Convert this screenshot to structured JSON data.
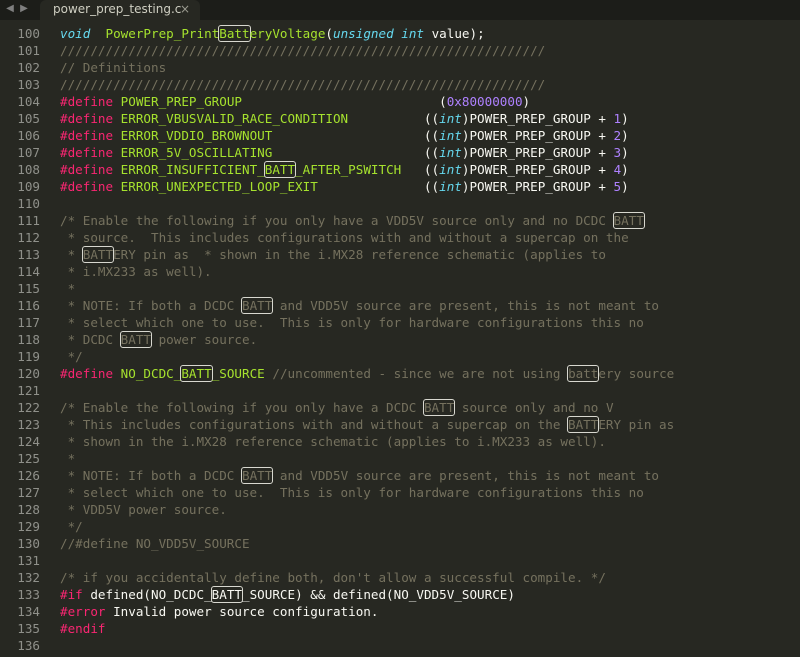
{
  "tab": {
    "filename": "power_prep_testing.c",
    "close_glyph": "×"
  },
  "nav": {
    "back_glyph": "◀",
    "forward_glyph": "▶"
  },
  "colors": {
    "background": "#272822",
    "keyword": "#f92672",
    "function": "#a6e22e",
    "type": "#66d9ef",
    "number": "#ae81ff",
    "comment": "#75715e",
    "text": "#f8f8f2",
    "line_number": "#8f908a"
  },
  "search_highlight": "batt",
  "lines": [
    {
      "no": "100",
      "tokens": [
        [
          "ty",
          "void"
        ],
        [
          "",
          "  "
        ],
        [
          "fn",
          "PowerPrep_Print"
        ],
        [
          "fn hl",
          "Batt"
        ],
        [
          "fn",
          "eryVoltage"
        ],
        [
          "",
          "("
        ],
        [
          "ty",
          "unsigned int"
        ],
        [
          "",
          " value);"
        ]
      ]
    },
    {
      "no": "101",
      "tokens": [
        [
          "cm",
          "////////////////////////////////////////////////////////////////"
        ]
      ]
    },
    {
      "no": "102",
      "tokens": [
        [
          "cm",
          "// Definitions"
        ]
      ]
    },
    {
      "no": "103",
      "tokens": [
        [
          "cm",
          "////////////////////////////////////////////////////////////////"
        ]
      ]
    },
    {
      "no": "104",
      "tokens": [
        [
          "kw",
          "#define"
        ],
        [
          "",
          " "
        ],
        [
          "mc",
          "POWER_PREP_GROUP"
        ],
        [
          "",
          "                          ("
        ],
        [
          "num",
          "0x80000000"
        ],
        [
          "",
          ")"
        ]
      ]
    },
    {
      "no": "105",
      "tokens": [
        [
          "kw",
          "#define"
        ],
        [
          "",
          " "
        ],
        [
          "mc",
          "ERROR_VBUSVALID_RACE_CONDITION"
        ],
        [
          "",
          "          (("
        ],
        [
          "ty",
          "int"
        ],
        [
          "",
          ")POWER_PREP_GROUP + "
        ],
        [
          "num",
          "1"
        ],
        [
          "",
          ")"
        ]
      ]
    },
    {
      "no": "106",
      "tokens": [
        [
          "kw",
          "#define"
        ],
        [
          "",
          " "
        ],
        [
          "mc",
          "ERROR_VDDIO_BROWNOUT"
        ],
        [
          "",
          "                    (("
        ],
        [
          "ty",
          "int"
        ],
        [
          "",
          ")POWER_PREP_GROUP + "
        ],
        [
          "num",
          "2"
        ],
        [
          "",
          ")"
        ]
      ]
    },
    {
      "no": "107",
      "tokens": [
        [
          "kw",
          "#define"
        ],
        [
          "",
          " "
        ],
        [
          "mc",
          "ERROR_5V_OSCILLATING"
        ],
        [
          "",
          "                    (("
        ],
        [
          "ty",
          "int"
        ],
        [
          "",
          ")POWER_PREP_GROUP + "
        ],
        [
          "num",
          "3"
        ],
        [
          "",
          ")"
        ]
      ]
    },
    {
      "no": "108",
      "tokens": [
        [
          "kw",
          "#define"
        ],
        [
          "",
          " "
        ],
        [
          "mc",
          "ERROR_INSUFFICIENT_"
        ],
        [
          "mc hl",
          "BATT"
        ],
        [
          "mc",
          "_AFTER_PSWITCH"
        ],
        [
          "",
          "   (("
        ],
        [
          "ty",
          "int"
        ],
        [
          "",
          ")POWER_PREP_GROUP + "
        ],
        [
          "num",
          "4"
        ],
        [
          "",
          ")"
        ]
      ]
    },
    {
      "no": "109",
      "tokens": [
        [
          "kw",
          "#define"
        ],
        [
          "",
          " "
        ],
        [
          "mc",
          "ERROR_UNEXPECTED_LOOP_EXIT"
        ],
        [
          "",
          "              (("
        ],
        [
          "ty",
          "int"
        ],
        [
          "",
          ")POWER_PREP_GROUP + "
        ],
        [
          "num",
          "5"
        ],
        [
          "",
          ")"
        ]
      ]
    },
    {
      "no": "110",
      "tokens": []
    },
    {
      "no": "111",
      "tokens": [
        [
          "cm",
          "/* Enable the following if you only have a VDD5V source only and no DCDC "
        ],
        [
          "cm hl",
          "BATT"
        ]
      ]
    },
    {
      "no": "112",
      "tokens": [
        [
          "cm",
          " * source.  This includes configurations with and without a supercap on the"
        ]
      ]
    },
    {
      "no": "113",
      "tokens": [
        [
          "cm",
          " * "
        ],
        [
          "cm hl",
          "BATT"
        ],
        [
          "cm",
          "ERY pin as  * shown in the i.MX28 reference schematic (applies to"
        ]
      ]
    },
    {
      "no": "114",
      "tokens": [
        [
          "cm",
          " * i.MX233 as well)."
        ]
      ]
    },
    {
      "no": "115",
      "tokens": [
        [
          "cm",
          " *"
        ]
      ]
    },
    {
      "no": "116",
      "tokens": [
        [
          "cm",
          " * NOTE: If both a DCDC "
        ],
        [
          "cm hl",
          "BATT"
        ],
        [
          "cm",
          " and VDD5V source are present, this is not meant to"
        ]
      ]
    },
    {
      "no": "117",
      "tokens": [
        [
          "cm",
          " * select which one to use.  This is only for hardware configurations this no"
        ]
      ]
    },
    {
      "no": "118",
      "tokens": [
        [
          "cm",
          " * DCDC "
        ],
        [
          "cm hl",
          "BATT"
        ],
        [
          "cm",
          " power source."
        ]
      ]
    },
    {
      "no": "119",
      "tokens": [
        [
          "cm",
          " */"
        ]
      ]
    },
    {
      "no": "120",
      "tokens": [
        [
          "kw",
          "#define"
        ],
        [
          "",
          " "
        ],
        [
          "mc",
          "NO_DCDC_"
        ],
        [
          "mc hl",
          "BATT"
        ],
        [
          "mc",
          "_SOURCE"
        ],
        [
          "",
          " "
        ],
        [
          "cm",
          "//uncommented - since we are not using "
        ],
        [
          "cm hl",
          "batt"
        ],
        [
          "cm",
          "ery source"
        ]
      ]
    },
    {
      "no": "121",
      "tokens": []
    },
    {
      "no": "122",
      "tokens": [
        [
          "cm",
          "/* Enable the following if you only have a DCDC "
        ],
        [
          "cm hl",
          "BATT"
        ],
        [
          "cm",
          " source only and no V"
        ]
      ]
    },
    {
      "no": "123",
      "tokens": [
        [
          "cm",
          " * This includes configurations with and without a supercap on the "
        ],
        [
          "cm hl",
          "BATT"
        ],
        [
          "cm",
          "ERY pin as"
        ]
      ]
    },
    {
      "no": "124",
      "tokens": [
        [
          "cm",
          " * shown in the i.MX28 reference schematic (applies to i.MX233 as well)."
        ]
      ]
    },
    {
      "no": "125",
      "tokens": [
        [
          "cm",
          " *"
        ]
      ]
    },
    {
      "no": "126",
      "tokens": [
        [
          "cm",
          " * NOTE: If both a DCDC "
        ],
        [
          "cm hl",
          "BATT"
        ],
        [
          "cm",
          " and VDD5V source are present, this is not meant to"
        ]
      ]
    },
    {
      "no": "127",
      "tokens": [
        [
          "cm",
          " * select which one to use.  This is only for hardware configurations this no"
        ]
      ]
    },
    {
      "no": "128",
      "tokens": [
        [
          "cm",
          " * VDD5V power source."
        ]
      ]
    },
    {
      "no": "129",
      "tokens": [
        [
          "cm",
          " */"
        ]
      ]
    },
    {
      "no": "130",
      "tokens": [
        [
          "cm",
          "//#define NO_VDD5V_SOURCE"
        ]
      ]
    },
    {
      "no": "131",
      "tokens": []
    },
    {
      "no": "132",
      "tokens": [
        [
          "cm",
          "/* if you accidentally define both, don't allow a successful compile. */"
        ]
      ]
    },
    {
      "no": "133",
      "tokens": [
        [
          "kw",
          "#if"
        ],
        [
          "",
          " defined(NO_DCDC_"
        ],
        [
          "hl",
          "BATT"
        ],
        [
          "",
          "_SOURCE) && defined(NO_VDD5V_SOURCE)"
        ]
      ]
    },
    {
      "no": "134",
      "tokens": [
        [
          "kw",
          "#error"
        ],
        [
          "",
          " Invalid power source configuration."
        ]
      ]
    },
    {
      "no": "135",
      "tokens": [
        [
          "kw",
          "#endif"
        ]
      ]
    },
    {
      "no": "136",
      "tokens": []
    }
  ]
}
